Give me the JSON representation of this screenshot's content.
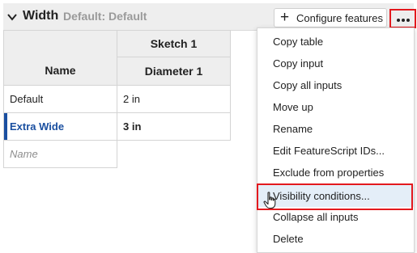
{
  "header": {
    "title": "Width",
    "subtitle": "Default: Default",
    "configure_label": "Configure features",
    "plus_glyph": "+",
    "more_icon": "more-horizontal-icon",
    "collapse_icon": "chevron-down-icon"
  },
  "table": {
    "col_name_header": "Name",
    "group_header": "Sketch 1",
    "col_value_header": "Diameter 1",
    "rows": [
      {
        "name": "Default",
        "value": "2 in",
        "active": false
      },
      {
        "name": "Extra Wide",
        "value": "3 in",
        "active": true
      }
    ],
    "new_row_placeholder": "Name"
  },
  "menu": {
    "items": [
      "Copy table",
      "Copy input",
      "Copy all inputs",
      "Move up",
      "Rename",
      "Edit FeatureScript IDs...",
      "Exclude from properties",
      "Visibility conditions...",
      "Collapse all inputs",
      "Delete"
    ],
    "hovered_item": "Visibility conditions..."
  },
  "colors": {
    "accent": "#1a4fa0",
    "highlight_frame": "#e3191e",
    "header_bg": "#eeeeee",
    "hover_bg": "#e4eef8"
  }
}
